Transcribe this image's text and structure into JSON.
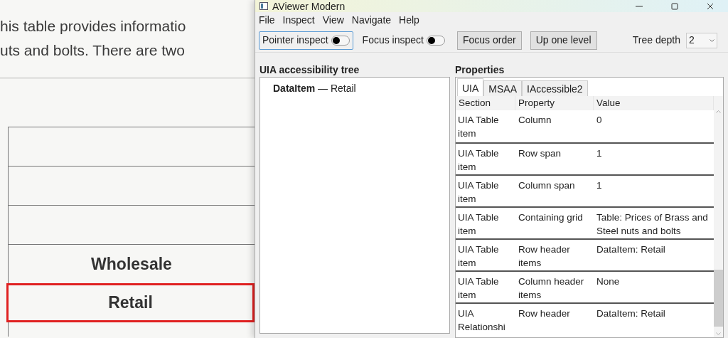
{
  "page": {
    "paragraph_lines": [
      "his table provides informatio",
      "uts and bolts. There are two"
    ],
    "table": {
      "rows": [
        {
          "highlighted": false
        },
        {
          "highlighted": false
        },
        {
          "highlighted": false
        },
        {
          "text": "Wholesale",
          "highlighted": false
        },
        {
          "text": "Retail",
          "highlighted": true
        }
      ]
    }
  },
  "window": {
    "title": "AViewer Modern",
    "menu": [
      "File",
      "Inspect",
      "View",
      "Navigate",
      "Help"
    ],
    "toolbar": [
      {
        "kind": "toggle",
        "label": "Pointer inspect",
        "on": false,
        "focused": true
      },
      {
        "kind": "toggle",
        "label": "Focus inspect",
        "on": false,
        "focused": false
      },
      {
        "kind": "button",
        "label": "Focus order"
      },
      {
        "kind": "button",
        "label": "Up one level"
      }
    ],
    "tree_depth": {
      "label": "Tree depth",
      "value": "2"
    },
    "tree": {
      "heading": "UIA accessibility tree",
      "items": [
        "**DataItem** — Retail"
      ]
    },
    "properties": {
      "heading": "Properties",
      "tabs": [
        {
          "label": "UIA",
          "selected": true
        },
        {
          "label": "MSAA",
          "selected": false
        },
        {
          "label": "IAccessible2",
          "selected": false
        }
      ],
      "columns": [
        "Section",
        "Property",
        "Value"
      ],
      "rows": [
        {
          "section": "UIA Table item",
          "property": "Column",
          "value": "0"
        },
        {
          "section": "UIA Table item",
          "property": "Row span",
          "value": "1"
        },
        {
          "section": "UIA Table item",
          "property": "Column span",
          "value": "1"
        },
        {
          "section": "UIA Table item",
          "property": "Containing grid",
          "value": "Table: Prices of Brass and Steel nuts and bolts"
        },
        {
          "section": "UIA Table item",
          "property": "Row header items",
          "value": "DataItem: Retail"
        },
        {
          "section": "UIA Table item",
          "property": "Column header items",
          "value": "None"
        },
        {
          "section": "UIA Relationshi",
          "property": "Row header",
          "value": "DataItem: Retail"
        }
      ]
    }
  }
}
